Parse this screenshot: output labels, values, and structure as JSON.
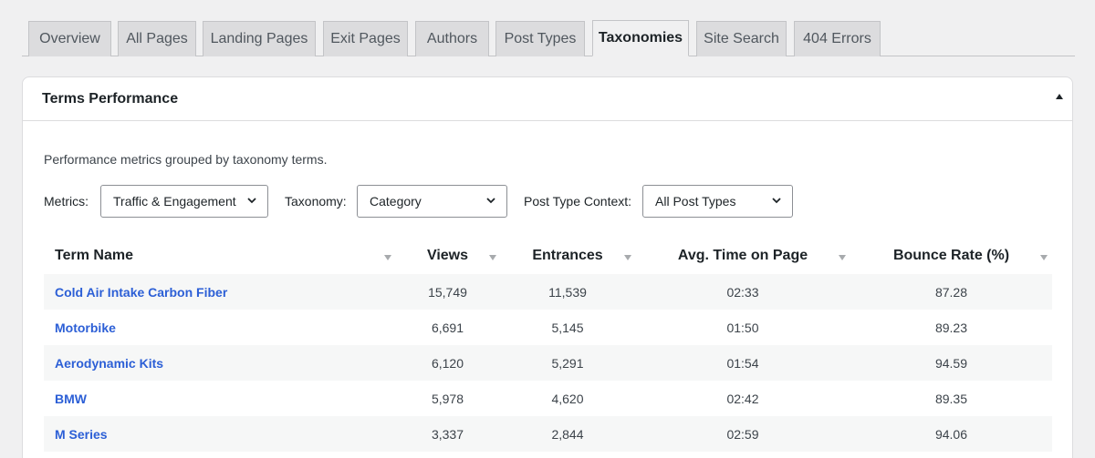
{
  "tabs": [
    {
      "label": "Overview"
    },
    {
      "label": "All Pages"
    },
    {
      "label": "Landing Pages"
    },
    {
      "label": "Exit Pages"
    },
    {
      "label": "Authors"
    },
    {
      "label": "Post Types"
    },
    {
      "label": "Taxonomies",
      "active": true
    },
    {
      "label": "Site Search"
    },
    {
      "label": "404 Errors"
    }
  ],
  "panel": {
    "title": "Terms Performance",
    "description": "Performance metrics grouped by taxonomy terms."
  },
  "filters": {
    "metrics_label": "Metrics:",
    "metrics_value": "Traffic & Engagement",
    "taxonomy_label": "Taxonomy:",
    "taxonomy_value": "Category",
    "context_label": "Post Type Context:",
    "context_value": "All Post Types"
  },
  "table": {
    "headers": [
      "Term Name",
      "Views",
      "Entrances",
      "Avg. Time on Page",
      "Bounce Rate (%)"
    ],
    "rows": [
      {
        "term": "Cold Air Intake Carbon Fiber",
        "views": "15,749",
        "entrances": "11,539",
        "avg_time": "02:33",
        "bounce": "87.28"
      },
      {
        "term": "Motorbike",
        "views": "6,691",
        "entrances": "5,145",
        "avg_time": "01:50",
        "bounce": "89.23"
      },
      {
        "term": "Aerodynamic Kits",
        "views": "6,120",
        "entrances": "5,291",
        "avg_time": "01:54",
        "bounce": "94.59"
      },
      {
        "term": "BMW",
        "views": "5,978",
        "entrances": "4,620",
        "avg_time": "02:42",
        "bounce": "89.35"
      },
      {
        "term": "M Series",
        "views": "3,337",
        "entrances": "2,844",
        "avg_time": "02:59",
        "bounce": "94.06"
      }
    ]
  },
  "colors": {
    "link": "#2c5fd6",
    "row_stripe": "#f6f7f7",
    "tab_bg": "#dcdcde"
  },
  "icons": {
    "collapse": "triangle-up-icon",
    "sort": "sort-down-icon",
    "select": "chevron-down-icon"
  }
}
